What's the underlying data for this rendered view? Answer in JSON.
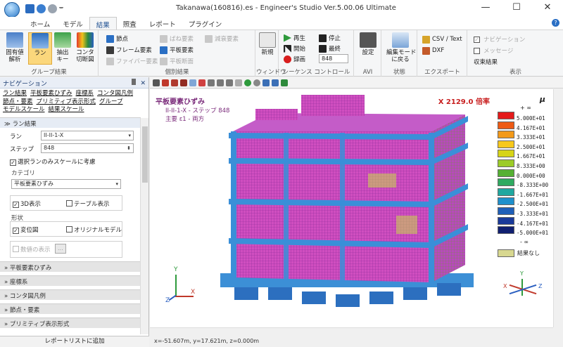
{
  "window": {
    "title": "Takanawa(160816).es - Engineer's Studio Ver.5.00.06 Ultimate",
    "min_glyph": "—",
    "max_glyph": "☐",
    "close_glyph": "✕"
  },
  "ribbon_tabs": [
    "ホーム",
    "モデル",
    "結果",
    "照査",
    "レポート",
    "プラグイン"
  ],
  "ribbon": {
    "group_results": {
      "label": "グループ結果",
      "buttons": [
        "固有値\n解析",
        "ラン",
        "抽出\nキー",
        "コンタ\n切断図"
      ]
    },
    "group_elements": {
      "label": "個別結果",
      "items": [
        "節点",
        "フレーム要素",
        "ファイバー要素",
        "ばね要素",
        "平板要素",
        "平板断面",
        "減衰要素"
      ]
    },
    "group_window": {
      "label": "ウィンドウ",
      "button": "新規"
    },
    "group_sequence": {
      "label": "シーケンス コントロール",
      "play": "再生",
      "stop": "停止",
      "start": "開始",
      "last": "最終",
      "record": "録画",
      "step_value": "848"
    },
    "group_avi": {
      "label": "AVI",
      "button": "設定"
    },
    "group_state": {
      "label": "状態",
      "button": "編集モード\nに戻る"
    },
    "group_export": {
      "label": "エクスポート",
      "csv": "CSV / Text",
      "dxf": "DXF"
    },
    "group_display": {
      "label": "表示",
      "navigation": "ナビゲーション",
      "message": "メッセージ",
      "summary": "収束結果"
    }
  },
  "panel": {
    "title": "ナビゲーション",
    "pin_glyph": "📌",
    "close_glyph": "✕",
    "links_row1": [
      "ラン結果",
      "平板要素ひずみ",
      "座標系",
      "コンタ図凡例"
    ],
    "links_row2": [
      "節点・要素",
      "プリミティブ表示形式",
      "グループ"
    ],
    "links_row3": [
      "モデルスケール",
      "結果スケール"
    ],
    "run_section": {
      "title": "ラン結果",
      "run_label": "ラン",
      "run_value": "II-II-1-X",
      "step_label": "ステップ",
      "step_value": "848",
      "only_selected_label": "選択ランのみスケールに考慮",
      "category_label": "カテゴリ",
      "category_value": "平板要素ひずみ",
      "show_3d_label": "3D表示",
      "show_table_label": "テーブル表示",
      "shape_label": "形状",
      "displacement_label": "変位図",
      "original_model_label": "オリジナルモデル",
      "show_values_label": "数値の表示",
      "show_values_btn": "..."
    },
    "collapsed_sections": [
      "平板要素ひずみ",
      "座標系",
      "コンタ図凡例",
      "節点・要素",
      "プリミティブ表示形式"
    ],
    "footer": "レポートリストに追加"
  },
  "viewport": {
    "title": "平板要素ひずみ",
    "sub1": "II-II-1-X - ステップ 848",
    "sub2": "主要 ε1 - 両方",
    "magnification": "X 2129.0 倍率",
    "axis_y": "Y",
    "axis_x": "X",
    "axis_z": "Z",
    "legend_symbol": "μ",
    "legend_top": "+ ∞",
    "legend_bottom": "- ∞",
    "legend_no_result": "結果なし",
    "legend_values": [
      "5.000E+01",
      "4.167E+01",
      "3.333E+01",
      "2.500E+01",
      "1.667E+01",
      "8.333E+00",
      "0.000E+00",
      "-8.333E+00",
      "-1.667E+01",
      "-2.500E+01",
      "-3.333E+01",
      "-4.167E+01",
      "-5.000E+01"
    ],
    "legend_colors": [
      "#e41a1a",
      "#ee5a14",
      "#f39a1a",
      "#f7c81c",
      "#d6d418",
      "#9ccc28",
      "#55b033",
      "#2faa60",
      "#1fa8a0",
      "#1e90cc",
      "#1f5fb8",
      "#1a3a9a",
      "#101f70"
    ],
    "no_result_color": "#d8d890"
  },
  "status": "x=-51.607m, y=17.621m, z=0.000m"
}
